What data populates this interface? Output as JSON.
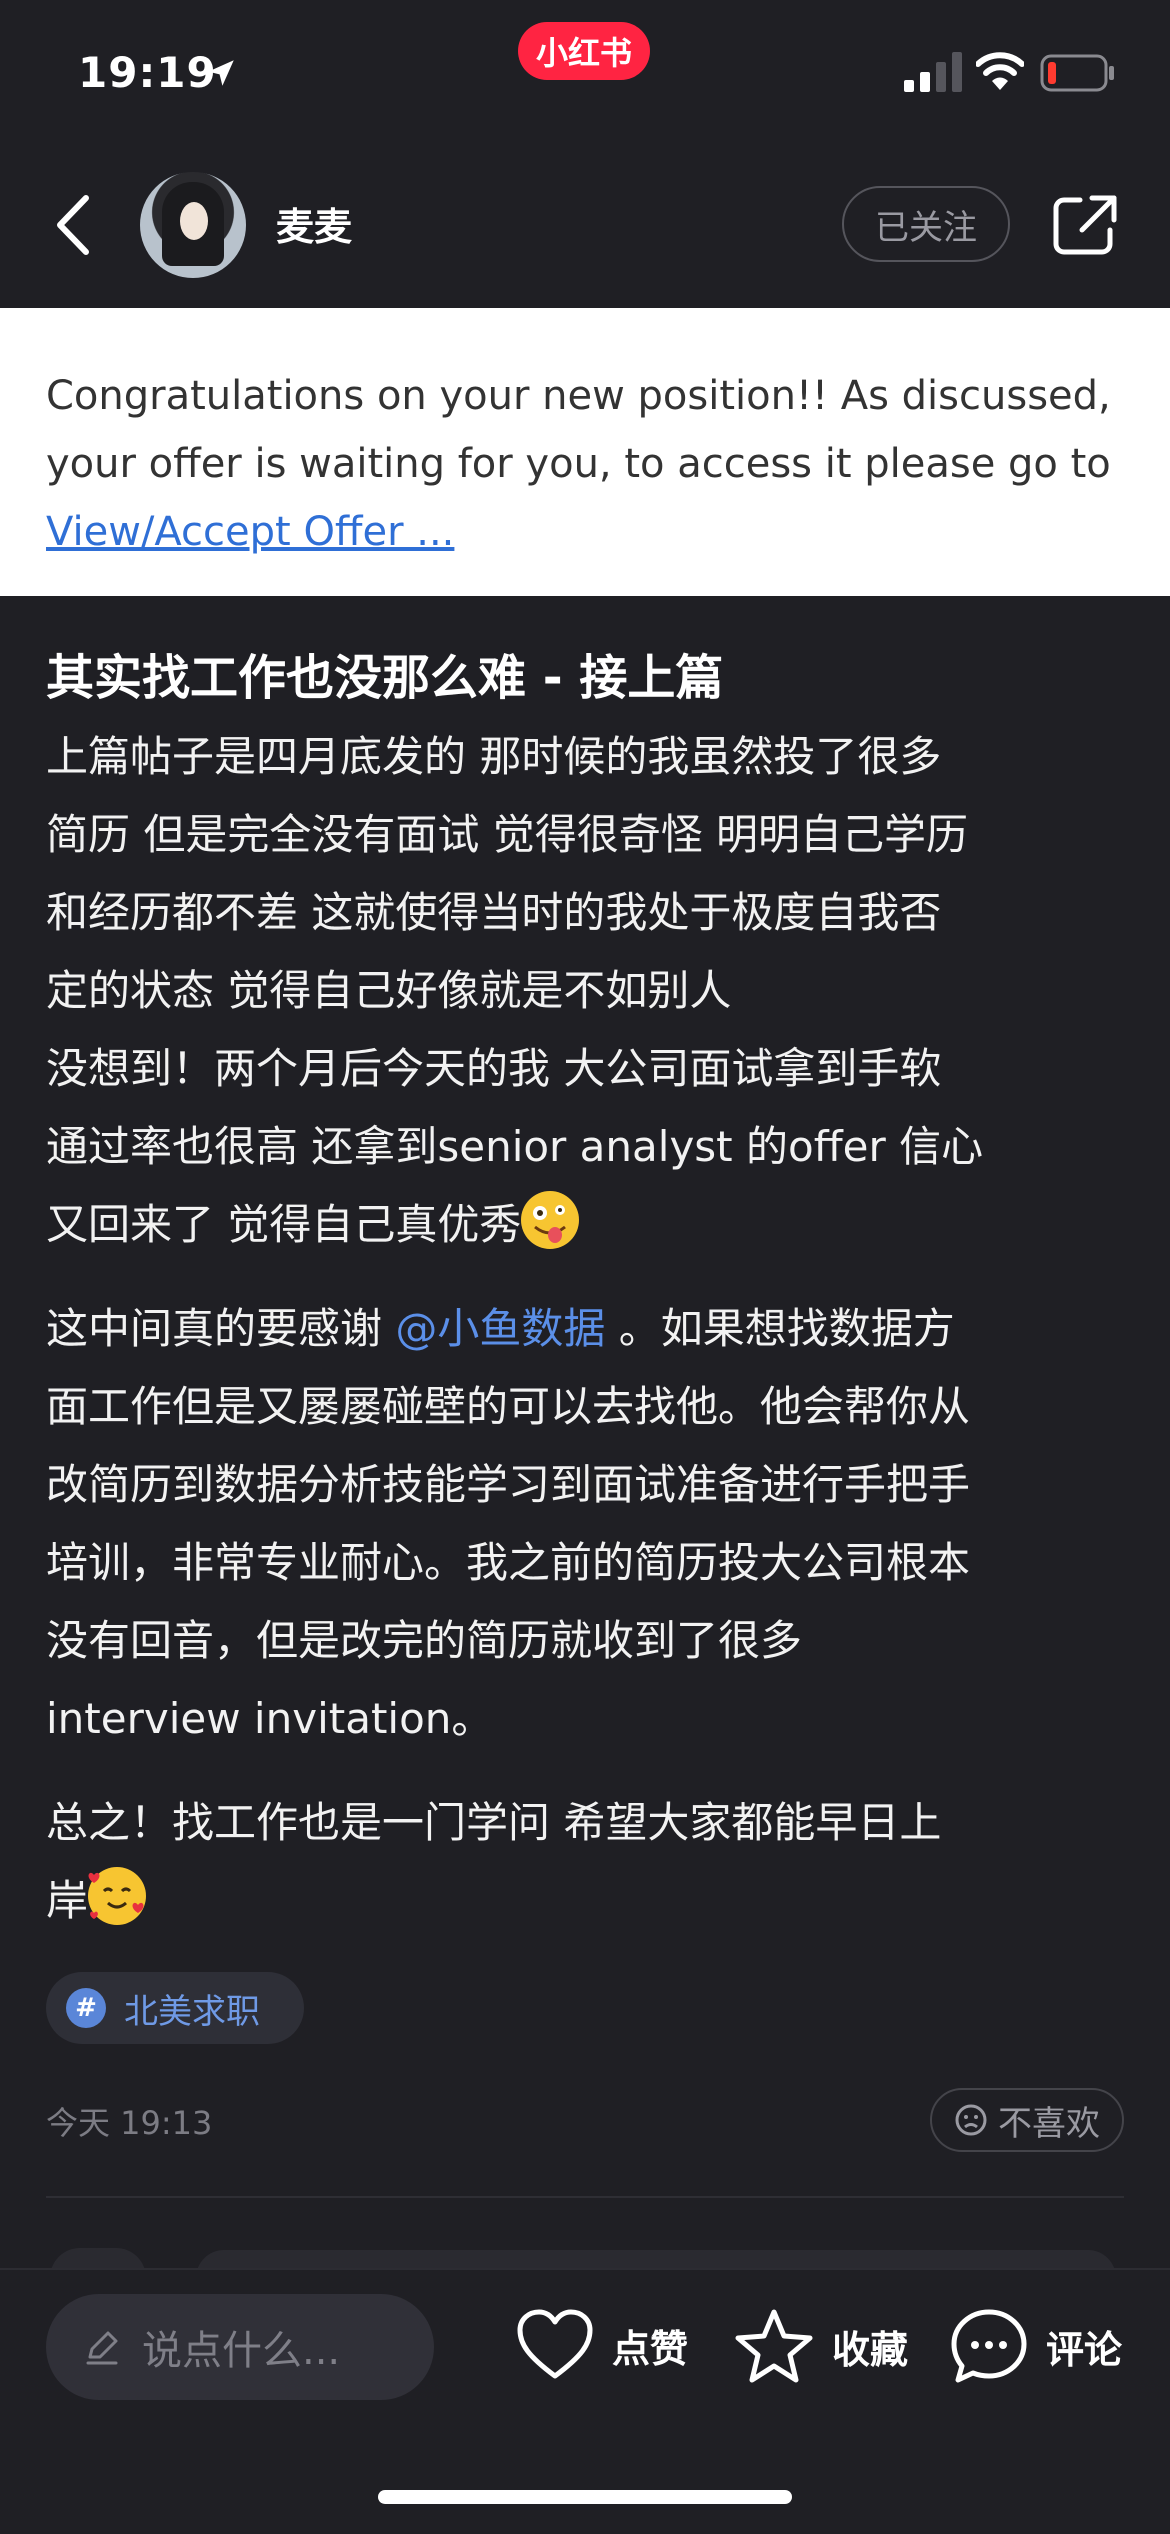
{
  "status_bar": {
    "time": "19:19",
    "app_badge": "小红书",
    "badge_color": "#ff2442",
    "battery_color": "#ff3b30"
  },
  "header": {
    "author_name": "麦麦",
    "follow_label": "已关注",
    "icons": [
      "back-arrow-icon",
      "avatar",
      "share-icon"
    ]
  },
  "banner": {
    "text": "Congratulations on your new position!! As discussed, your offer is waiting for you, to access it please go to",
    "link_text": "View/Accept Offer ..."
  },
  "post": {
    "title": "其实找工作也没那么难 - 接上篇",
    "para1_lines": [
      "上篇帖子是四月底发的 那时候的我虽然投了很多",
      "简历 但是完全没有面试 觉得很奇怪 明明自己学历",
      "和经历都不差 这就使得当时的我处于极度自我否",
      "定的状态 觉得自己好像就是不如别人",
      "没想到！两个月后今天的我 大公司面试拿到手软",
      "通过率也很高 还拿到senior analyst 的offer 信心",
      "又回来了 觉得自己真优秀"
    ],
    "para2_prefix": "这中间真的要感谢 ",
    "mention": "@小鱼数据",
    "para2_line1_suffix": " 。如果想找数据方",
    "para2_lines": [
      "面工作但是又屡屡碰壁的可以去找他。他会帮你从",
      "改简历到数据分析技能学习到面试准备进行手把手",
      "培训，非常专业耐心。我之前的简历投大公司根本",
      "没有回音，但是改完的简历就收到了很多",
      "interview invitation。"
    ],
    "para3_lines": [
      "总之！找工作也是一门学问 希望大家都能早日上",
      "岸"
    ],
    "tag": "北美求职",
    "timestamp": "今天 19:13",
    "dislike_label": "不喜欢"
  },
  "bottom_bar": {
    "comment_placeholder": "说点什么...",
    "like_label": "点赞",
    "collect_label": "收藏",
    "comment_label": "评论"
  }
}
